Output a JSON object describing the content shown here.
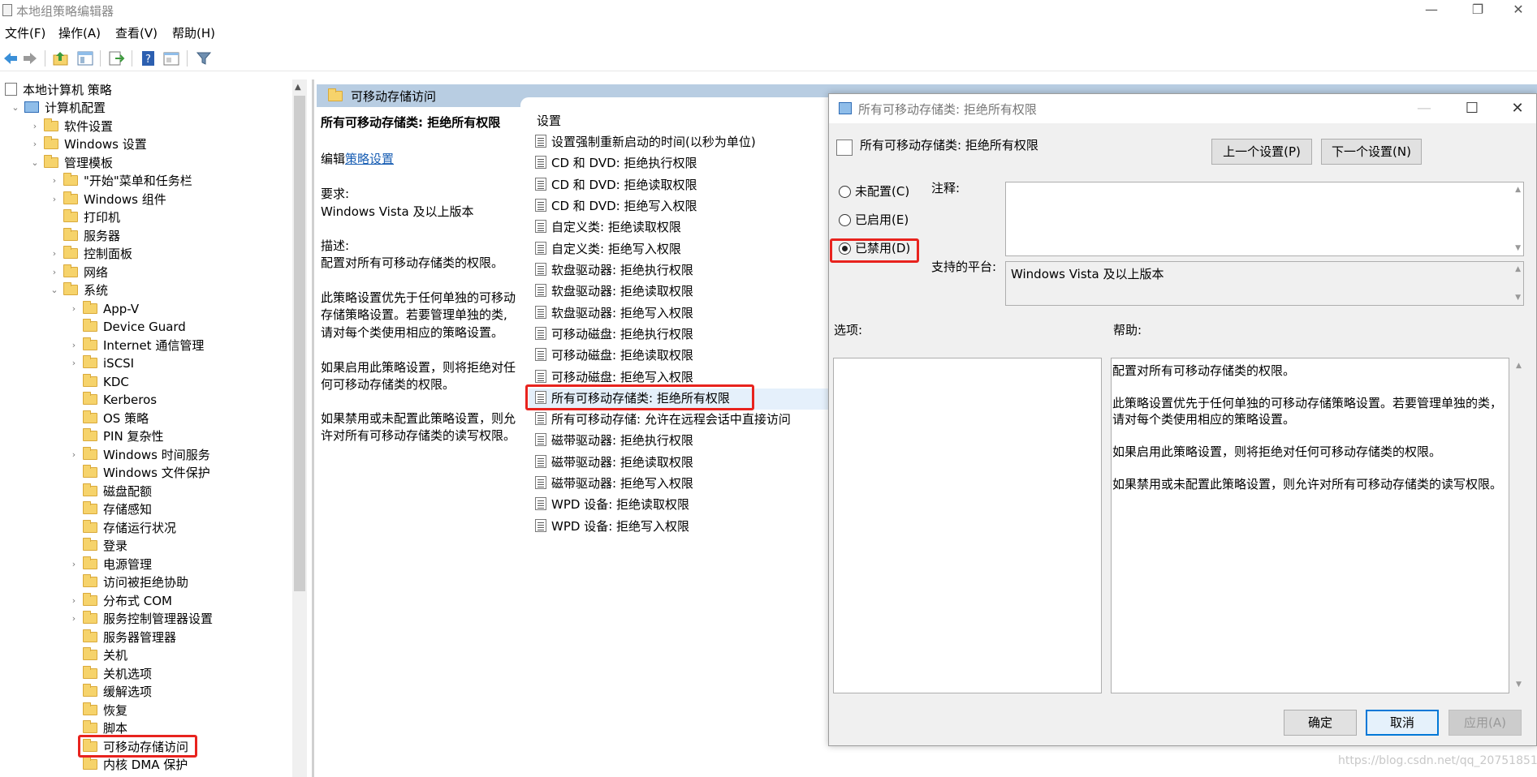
{
  "window": {
    "title": "本地组策略编辑器",
    "minimize": "—",
    "restore": "❐",
    "close": "✕"
  },
  "menu": [
    "文件(F)",
    "操作(A)",
    "查看(V)",
    "帮助(H)"
  ],
  "toolbar": {
    "icons": [
      "back-arrow-icon",
      "forward-arrow-icon",
      "up-folder-icon",
      "show-hide-tree-icon",
      "export-list-icon",
      "help-icon",
      "properties-icon",
      "filter-icon"
    ]
  },
  "tree": {
    "items": [
      "本地计算机 策略",
      "计算机配置",
      "软件设置",
      "Windows 设置",
      "管理模板",
      "\"开始\"菜单和任务栏",
      "Windows 组件",
      "打印机",
      "服务器",
      "控制面板",
      "网络",
      "系统",
      "App-V",
      "Device Guard",
      "Internet 通信管理",
      "iSCSI",
      "KDC",
      "Kerberos",
      "OS 策略",
      "PIN 复杂性",
      "Windows 时间服务",
      "Windows 文件保护",
      "磁盘配额",
      "存储感知",
      "存储运行状况",
      "登录",
      "电源管理",
      "访问被拒绝协助",
      "分布式 COM",
      "服务控制管理器设置",
      "服务器管理器",
      "关机",
      "关机选项",
      "缓解选项",
      "恢复",
      "脚本",
      "可移动存储访问",
      "内核 DMA 保护"
    ]
  },
  "middle": {
    "header": "可移动存储访问",
    "desc_title": "所有可移动存储类: 拒绝所有权限",
    "edit_prefix": "编辑",
    "edit_link": "策略设置",
    "requirement_label": "要求:",
    "requirement_value": "Windows Vista 及以上版本",
    "description_label": "描述:",
    "description_1": "配置对所有可移动存储类的权限。",
    "description_2_l1": "此策略设置优先于任何单独的可移动",
    "description_2_l2": "存储策略设置。若要管理单独的类,",
    "description_2_l3": "请对每个类使用相应的策略设置。",
    "description_3_l1": "如果启用此策略设置，则将拒绝对任",
    "description_3_l2": "何可移动存储类的权限。",
    "description_4_l1": "如果禁用或未配置此策略设置，则允",
    "description_4_l2": "许对所有可移动存储类的读写权限。",
    "settings_header": "设置",
    "settings": [
      "设置强制重新启动的时间(以秒为单位)",
      "CD 和 DVD: 拒绝执行权限",
      "CD 和 DVD: 拒绝读取权限",
      "CD 和 DVD: 拒绝写入权限",
      "自定义类: 拒绝读取权限",
      "自定义类: 拒绝写入权限",
      "软盘驱动器: 拒绝执行权限",
      "软盘驱动器: 拒绝读取权限",
      "软盘驱动器: 拒绝写入权限",
      "可移动磁盘: 拒绝执行权限",
      "可移动磁盘: 拒绝读取权限",
      "可移动磁盘: 拒绝写入权限",
      "所有可移动存储类: 拒绝所有权限",
      "所有可移动存储: 允许在远程会话中直接访问",
      "磁带驱动器: 拒绝执行权限",
      "磁带驱动器: 拒绝读取权限",
      "磁带驱动器: 拒绝写入权限",
      "WPD 设备: 拒绝读取权限",
      "WPD 设备: 拒绝写入权限"
    ]
  },
  "dialog": {
    "title": "所有可移动存储类: 拒绝所有权限",
    "policy_title": "所有可移动存储类: 拒绝所有权限",
    "prev_button": "上一个设置(P)",
    "next_button": "下一个设置(N)",
    "radio_not_configured": "未配置(C)",
    "radio_enabled": "已启用(E)",
    "radio_disabled": "已禁用(D)",
    "selected": "已禁用(D)",
    "comment_label": "注释:",
    "comment_value": "",
    "supported_label": "支持的平台:",
    "supported_value": "Windows Vista 及以上版本",
    "options_label": "选项:",
    "help_label": "帮助:",
    "help_1": "配置对所有可移动存储类的权限。",
    "help_2_l1": "此策略设置优先于任何单独的可移动存储策略设置。若要管理单独的类，",
    "help_2_l2": "请对每个类使用相应的策略设置。",
    "help_3": "如果启用此策略设置，则将拒绝对任何可移动存储类的权限。",
    "help_4": "如果禁用或未配置此策略设置，则允许对所有可移动存储类的读写权限。",
    "ok_button": "确定",
    "cancel_button": "取消",
    "apply_button": "应用(A)"
  },
  "watermark": "https://blog.csdn.net/qq_20751851",
  "colors": {
    "highlight": "#e8231e",
    "header_bg": "#b8cde2",
    "selected_row": "#e5f0fb",
    "accent": "#0078d7"
  }
}
